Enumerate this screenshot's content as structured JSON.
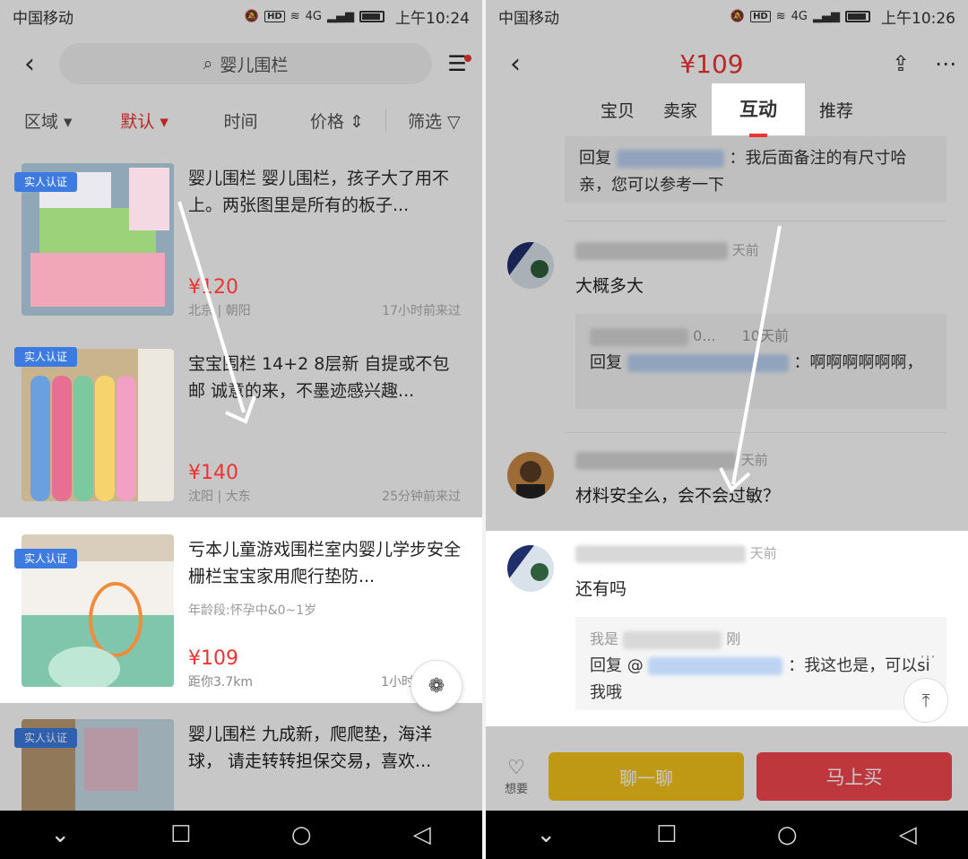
{
  "status_left": {
    "carrier": "中国移动",
    "net": "4G",
    "time": "上午10:24"
  },
  "status_right": {
    "carrier": "中国移动",
    "net": "4G",
    "time": "上午10:26"
  },
  "left": {
    "search_placeholder": "婴儿围栏",
    "filters": [
      {
        "label": "区域"
      },
      {
        "label": "默认"
      },
      {
        "label": "时间"
      },
      {
        "label": "价格"
      },
      {
        "label": "筛选"
      }
    ],
    "items": [
      {
        "badge": "实人认证",
        "title": "婴儿围栏 婴儿围栏，孩子大了用不上。两张图里是所有的板子...",
        "price": "¥120",
        "location": "北京 | 朝阳",
        "time": "17小时前来过"
      },
      {
        "badge": "实人认证",
        "title": "宝宝围栏 14+2 8层新 自提或不包邮 诚意的来，不墨迹感兴趣...",
        "price": "¥140",
        "location": "沈阳 | 大东",
        "time": "25分钟前来过"
      },
      {
        "badge": "实人认证",
        "title": "亏本儿童游戏围栏室内婴儿学步安全栅栏宝宝家用爬行垫防...",
        "subtitle": "年龄段:怀孕中&0~1岁",
        "price": "¥109",
        "location": "距你3.7km",
        "time": "1小时"
      },
      {
        "badge": "实人认证",
        "title": "婴儿围栏 九成新，爬爬垫，海洋球， 请走转转担保交易，喜欢..."
      }
    ]
  },
  "right": {
    "price": "¥109",
    "tabs": [
      {
        "label": "宝贝"
      },
      {
        "label": "卖家"
      },
      {
        "label": "互动"
      },
      {
        "label": "推荐"
      }
    ],
    "reply0": {
      "prefix": "回复",
      "text": "：我后面备注的有尺寸哈亲，您可以参考一下"
    },
    "c1": {
      "time": "天前",
      "text": "大概多大",
      "reply_who_tail": "0...",
      "reply_who_time": "10天前",
      "reply_prefix": "回复",
      "reply_text": "：啊啊啊啊啊啊，"
    },
    "c2": {
      "time": "天前",
      "text": "材料安全么，会不会过敏？"
    },
    "c3": {
      "time": "天前",
      "text": "还有吗",
      "reply_who": "我是",
      "reply_who_tail": "刚",
      "reply_prefix": "回复 @",
      "reply_text": "：我这也是，可以si我哦"
    },
    "want_label": "想要",
    "chat_label": "聊一聊",
    "buy_label": "马上买"
  }
}
